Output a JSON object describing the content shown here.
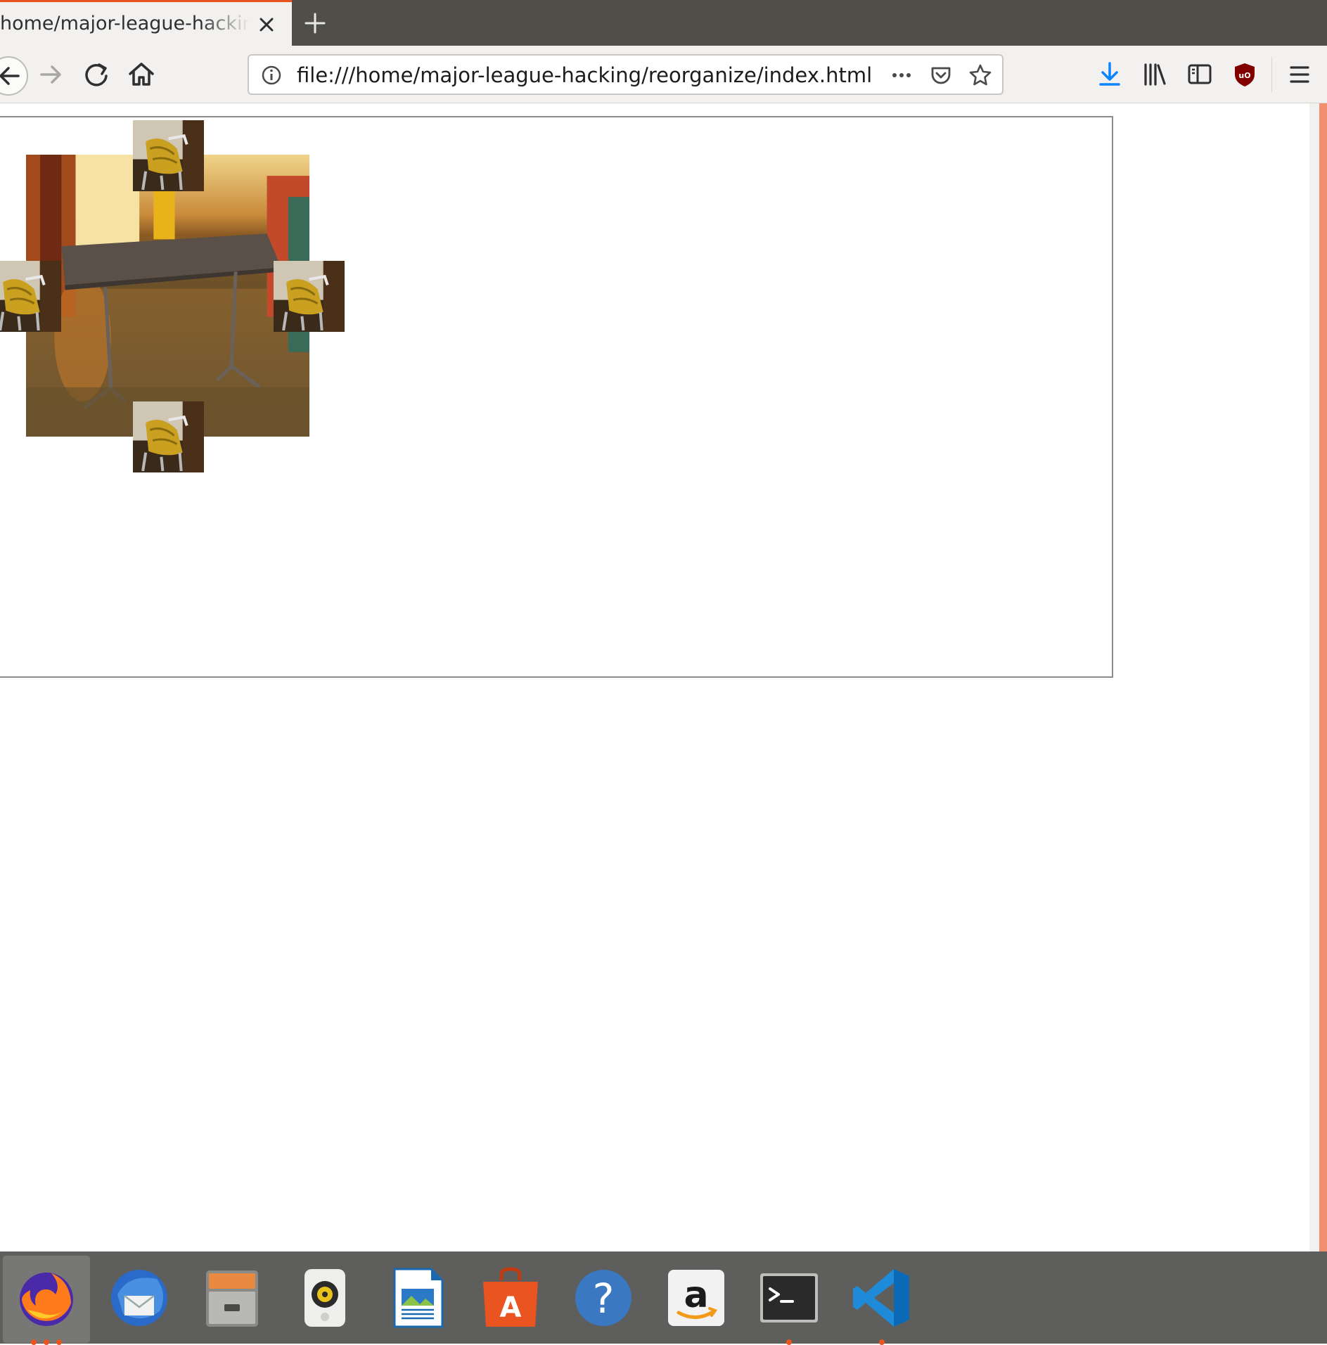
{
  "browser": {
    "tab_title": "home/major-league-hacking/reorganize/index.html",
    "url": "file:///home/major-league-hacking/reorganize/index.html"
  },
  "page": {
    "images": [
      {
        "name": "table",
        "icon": "table-photo"
      },
      {
        "name": "chair-top",
        "icon": "chair-photo"
      },
      {
        "name": "chair-left",
        "icon": "chair-photo"
      },
      {
        "name": "chair-right",
        "icon": "chair-photo"
      },
      {
        "name": "chair-bottom",
        "icon": "chair-photo"
      }
    ]
  },
  "toolbar_icons": [
    "back-icon",
    "forward-icon",
    "reload-icon",
    "home-icon",
    "site-info-icon",
    "page-actions-icon",
    "pocket-icon",
    "bookmark-star-icon",
    "downloads-icon",
    "library-icon",
    "sidebar-icon",
    "ublock-icon",
    "hamburger-menu-icon"
  ],
  "dock": {
    "items": [
      "firefox-icon",
      "thunderbird-icon",
      "files-icon",
      "rhythmbox-icon",
      "libreoffice-writer-icon",
      "software-center-icon",
      "help-icon",
      "amazon-icon",
      "terminal-icon",
      "vscode-icon"
    ]
  },
  "colors": {
    "accent": "#e95420",
    "tabstrip": "#4f4e49",
    "toolbar": "#f2f1f0",
    "dock": "#5e5e5c",
    "download_blue": "#0a84ff"
  }
}
